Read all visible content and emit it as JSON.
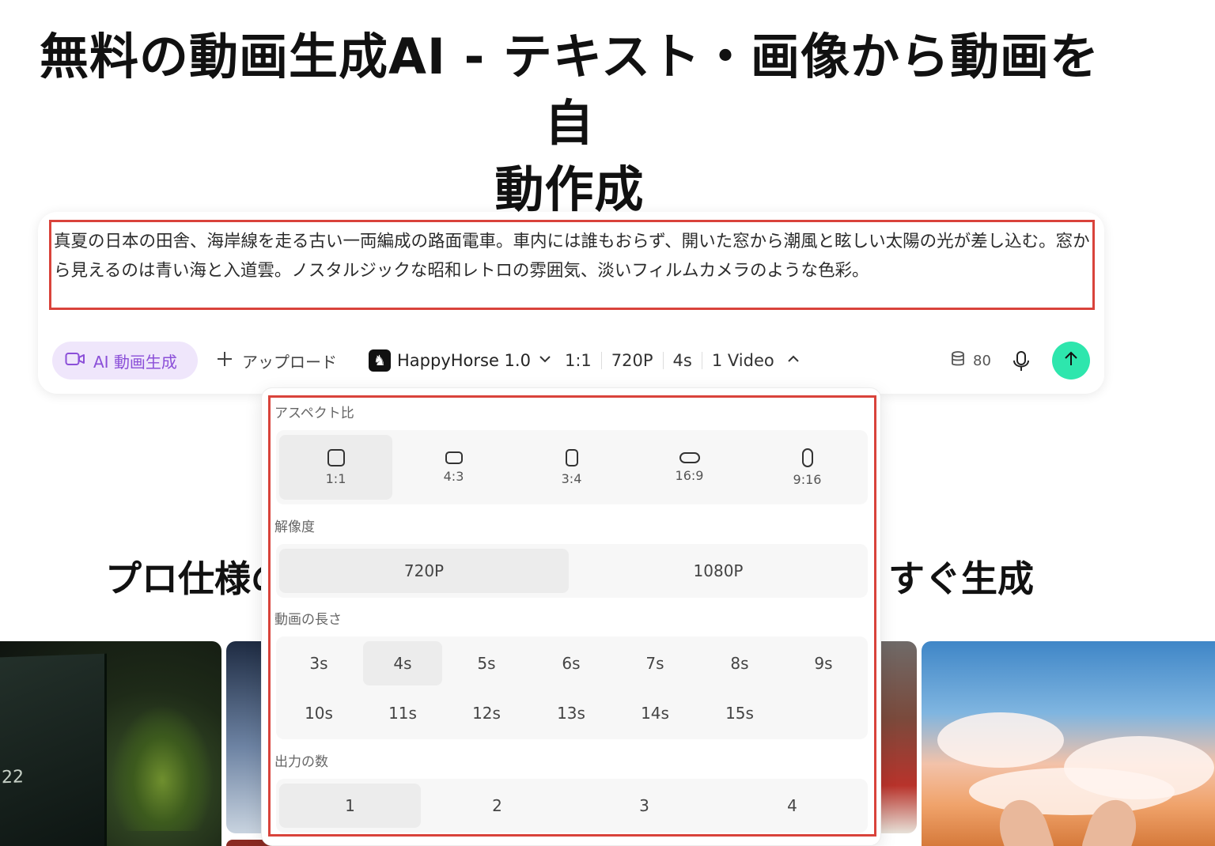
{
  "hero": {
    "title_line1": "無料の動画生成AI - テキスト・画像から動画を自",
    "title_line2": "動作成"
  },
  "prompt": {
    "text": "真夏の日本の田舎、海岸線を走る古い一両編成の路面電車。車内には誰もおらず、開いた窓から潮風と眩しい太陽の光が差し込む。窓から見えるのは青い海と入道雲。ノスタルジックな昭和レトロの雰囲気、淡いフィルムカメラのような色彩。"
  },
  "toolbar": {
    "mode_label": "AI 動画生成",
    "upload_label": "アップロード",
    "model_label": "HappyHorse 1.0",
    "summary": [
      "1:1",
      "720P",
      "4s",
      "1 Video"
    ],
    "credits": "80",
    "accent_color": "#8b4fd8",
    "send_color": "#2ee6ad"
  },
  "section": {
    "title_left": "プロ仕様の",
    "title_right": "すぐ生成"
  },
  "gallery": {
    "thumb1_text": "22"
  },
  "dropdown": {
    "aspect_label": "アスペクト比",
    "aspect_options": [
      "1:1",
      "4:3",
      "3:4",
      "16:9",
      "9:16"
    ],
    "aspect_selected": "1:1",
    "resolution_label": "解像度",
    "resolution_options": [
      "720P",
      "1080P"
    ],
    "resolution_selected": "720P",
    "duration_label": "動画の長さ",
    "duration_options": [
      "3s",
      "4s",
      "5s",
      "6s",
      "7s",
      "8s",
      "9s",
      "10s",
      "11s",
      "12s",
      "13s",
      "14s",
      "15s"
    ],
    "duration_selected": "4s",
    "count_label": "出力の数",
    "count_options": [
      "1",
      "2",
      "3",
      "4"
    ],
    "count_selected": "1",
    "highlight_color": "#d9433b"
  }
}
